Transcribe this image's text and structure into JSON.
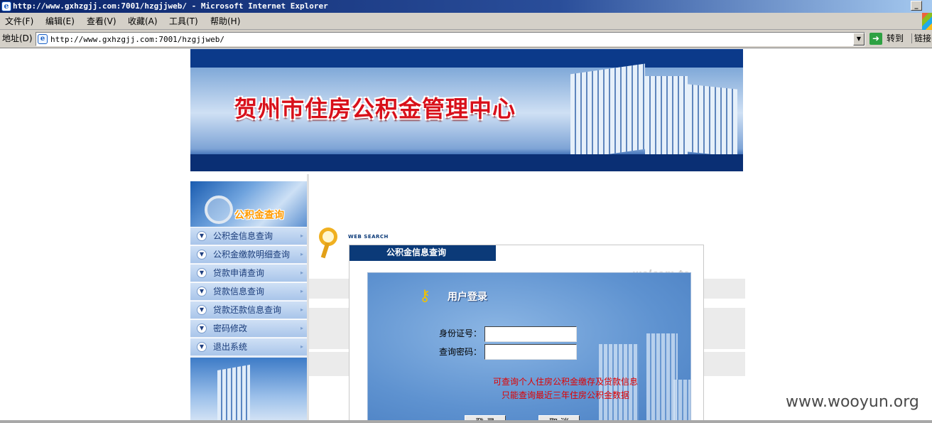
{
  "window": {
    "title": "http://www.gxhzgjj.com:7001/hzgjjweb/ - Microsoft Internet Explorer",
    "minimize_label": "_"
  },
  "menubar": {
    "items": [
      "文件(F)",
      "编辑(E)",
      "查看(V)",
      "收藏(A)",
      "工具(T)",
      "帮助(H)"
    ]
  },
  "address": {
    "label": "地址(D)",
    "url": "http://www.gxhzgjj.com:7001/hzgjjweb/",
    "go_label": "转到",
    "links_label": "链接"
  },
  "banner": {
    "title": "贺州市住房公积金管理中心"
  },
  "sidebar": {
    "header": "公积金查询",
    "items": [
      {
        "label": "公积金信息查询"
      },
      {
        "label": "公积金缴款明细查询"
      },
      {
        "label": "贷款申请查询"
      },
      {
        "label": "贷款信息查询"
      },
      {
        "label": "贷款还款信息查询"
      },
      {
        "label": "密码修改"
      },
      {
        "label": "退出系统"
      }
    ]
  },
  "search": {
    "caption": "WEB SEARCH",
    "title": "公积金信息查询",
    "welcome": "welcom to"
  },
  "login": {
    "heading": "用户登录",
    "id_label": "身份证号：",
    "id_value": "",
    "pwd_label": "查询密码：",
    "pwd_value": "",
    "note_line1": "可查询个人住房公积金缴存及贷款信息",
    "note_line2": "只能查询最近三年住房公积金数据",
    "submit_label": "登 录",
    "cancel_label": "取 消"
  },
  "watermark": "www.wooyun.org",
  "colors": {
    "title_red": "#d8101a",
    "navy": "#0b3a78",
    "note_red": "#e00000"
  }
}
